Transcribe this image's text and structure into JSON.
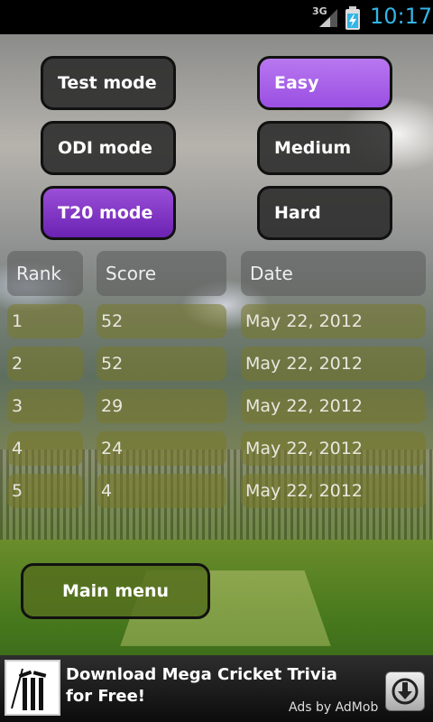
{
  "status_bar": {
    "network": "3G",
    "time": "10:17"
  },
  "modes": {
    "test": "Test mode",
    "odi": "ODI mode",
    "t20": "T20 mode",
    "selected_mode": "T20 mode"
  },
  "difficulty": {
    "easy": "Easy",
    "medium": "Medium",
    "hard": "Hard",
    "selected_difficulty": "Easy"
  },
  "scores_table": {
    "headers": {
      "rank": "Rank",
      "score": "Score",
      "date": "Date"
    },
    "rows": [
      {
        "rank": "1",
        "score": "52",
        "date": "May 22, 2012"
      },
      {
        "rank": "2",
        "score": "52",
        "date": "May 22, 2012"
      },
      {
        "rank": "3",
        "score": "29",
        "date": "May 22, 2012"
      },
      {
        "rank": "4",
        "score": "24",
        "date": "May 22, 2012"
      },
      {
        "rank": "5",
        "score": "4",
        "date": "May 22, 2012"
      }
    ]
  },
  "main_menu_label": "Main menu",
  "ad": {
    "text": "Download Mega Cricket Trivia for Free!",
    "attribution": "Ads by AdMob"
  },
  "colors": {
    "selected_purple": "#6b22b2",
    "easy_purple": "#b877f0",
    "clock_blue": "#33b5e5"
  }
}
